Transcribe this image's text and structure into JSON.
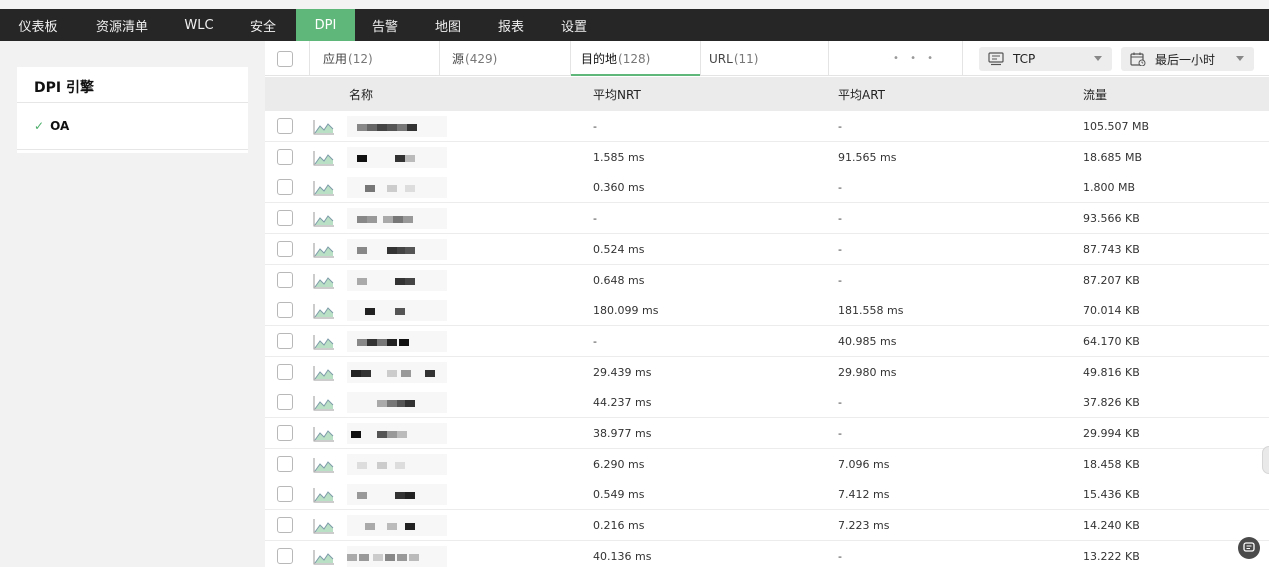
{
  "nav": {
    "items": [
      "仪表板",
      "资源清单",
      "WLC",
      "安全",
      "DPI",
      "告警",
      "地图",
      "报表",
      "设置"
    ],
    "active": "DPI"
  },
  "left_panel": {
    "title": "DPI 引擎",
    "items": [
      {
        "label": "OA",
        "checked": true
      }
    ]
  },
  "tabs": [
    {
      "label": "应用",
      "count": "(12)"
    },
    {
      "label": "源",
      "count": "(429)"
    },
    {
      "label": "目的地",
      "count": "(128)",
      "selected": true
    },
    {
      "label": "URL",
      "count": "(11)"
    }
  ],
  "more_label": "• • •",
  "protocol_select": {
    "value": "TCP",
    "icon": "protocol-icon"
  },
  "time_select": {
    "value": "最后一小时",
    "icon": "calendar-icon"
  },
  "table": {
    "columns": [
      "名称",
      "平均NRT",
      "平均ART",
      "流量"
    ],
    "rows": [
      {
        "nrt": "-",
        "art": "-",
        "traffic": "105.507 MB"
      },
      {
        "nrt": "1.585 ms",
        "art": "91.565 ms",
        "traffic": "18.685 MB"
      },
      {
        "nrt": "0.360 ms",
        "art": "-",
        "traffic": "1.800 MB"
      },
      {
        "nrt": "-",
        "art": "-",
        "traffic": "93.566 KB"
      },
      {
        "nrt": "0.524 ms",
        "art": "-",
        "traffic": "87.743 KB"
      },
      {
        "nrt": "0.648 ms",
        "art": "-",
        "traffic": "87.207 KB"
      },
      {
        "nrt": "180.099 ms",
        "art": "181.558 ms",
        "traffic": "70.014 KB"
      },
      {
        "nrt": "-",
        "art": "40.985 ms",
        "traffic": "64.170 KB"
      },
      {
        "nrt": "29.439 ms",
        "art": "29.980 ms",
        "traffic": "49.816 KB"
      },
      {
        "nrt": "44.237 ms",
        "art": "-",
        "traffic": "37.826 KB"
      },
      {
        "nrt": "38.977 ms",
        "art": "-",
        "traffic": "29.994 KB"
      },
      {
        "nrt": "6.290 ms",
        "art": "7.096 ms",
        "traffic": "18.458 KB"
      },
      {
        "nrt": "0.549 ms",
        "art": "7.412 ms",
        "traffic": "15.436 KB"
      },
      {
        "nrt": "0.216 ms",
        "art": "7.223 ms",
        "traffic": "14.240 KB"
      },
      {
        "nrt": "40.136 ms",
        "art": "-",
        "traffic": "13.222 KB"
      }
    ]
  },
  "colors": {
    "accent": "#5fb87a",
    "navbar": "#262626",
    "check": "#4caf6a"
  }
}
